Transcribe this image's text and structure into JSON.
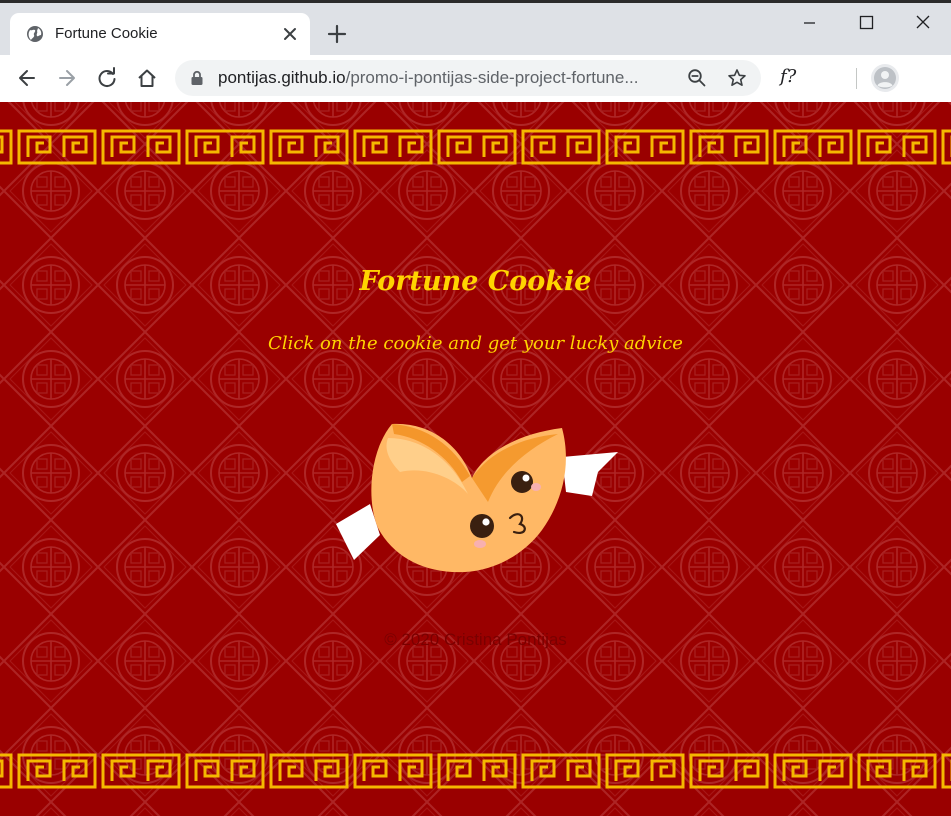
{
  "browser": {
    "tab_title": "Fortune Cookie",
    "url_host": "pontijas.github.io",
    "url_path": "/promo-i-pontijas-side-project-fortune...",
    "extension_label": "f?",
    "icons": {
      "favicon": "globe-icon",
      "tab_close": "close-icon",
      "new_tab": "plus-icon",
      "minimize": "minimize-icon",
      "maximize": "maximize-icon",
      "close": "close-icon",
      "back": "arrow-left-icon",
      "forward": "arrow-right-icon",
      "reload": "reload-icon",
      "home": "home-icon",
      "lock": "lock-icon",
      "zoom": "zoom-out-icon",
      "bookmark": "star-icon",
      "profile": "avatar-icon"
    }
  },
  "page": {
    "title": "Fortune Cookie",
    "subtitle": "Click on the cookie and get your lucky advice",
    "footer": "© 2020 Cristina Pontijas",
    "colors": {
      "background": "#9a0000",
      "accent": "#ffd400",
      "cookie": "#ffb865"
    }
  }
}
